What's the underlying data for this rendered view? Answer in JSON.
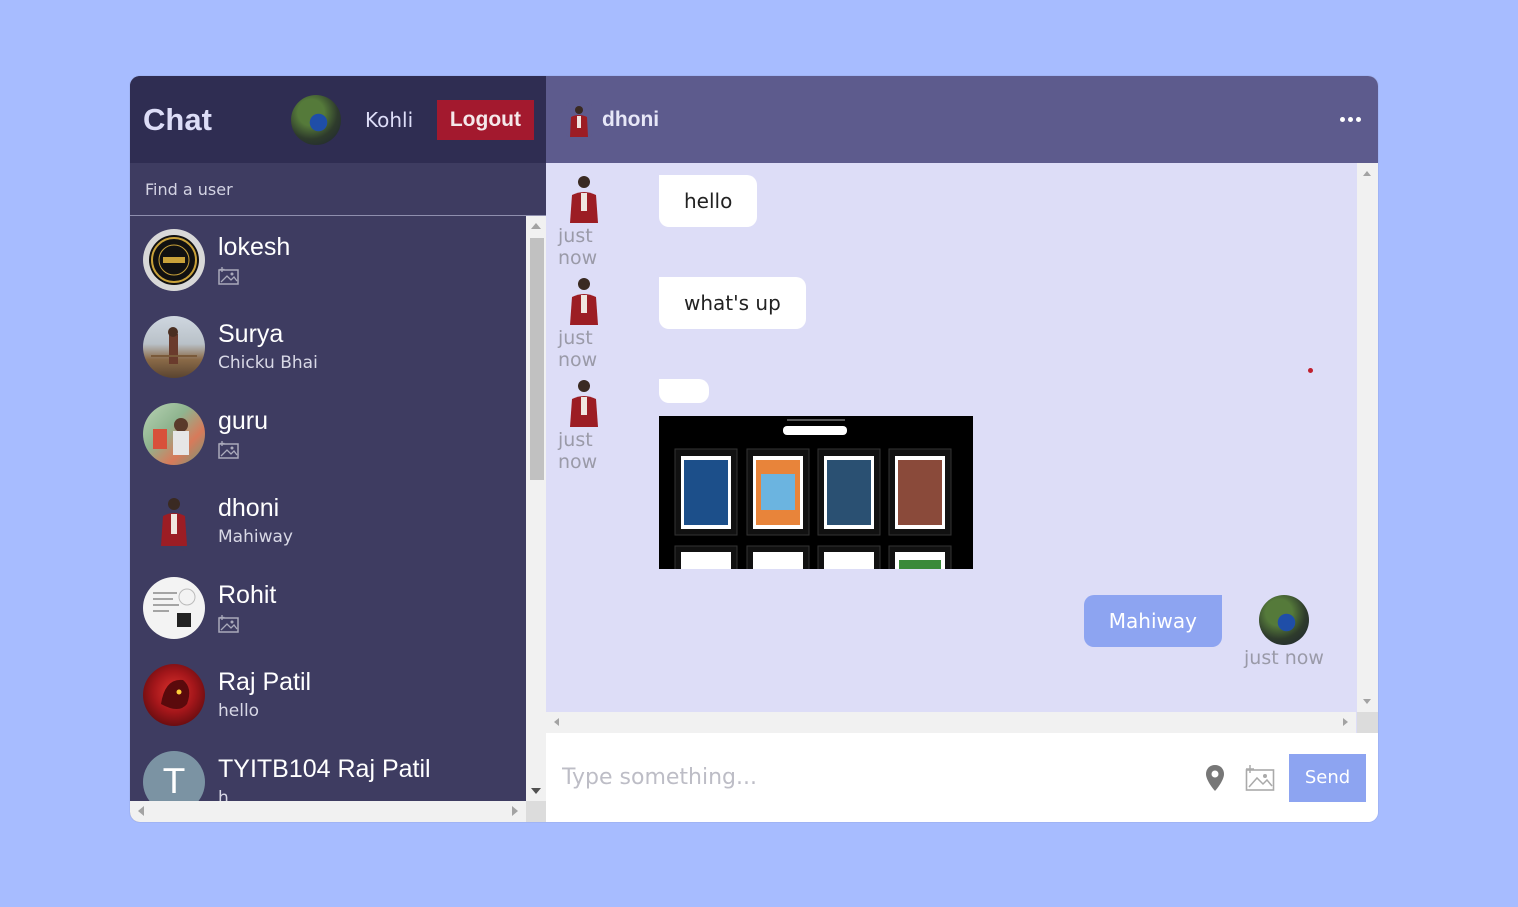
{
  "navbar": {
    "logo": "Chat",
    "current_user": "Kohli",
    "logout_label": "Logout"
  },
  "search": {
    "placeholder": "Find a user"
  },
  "chats": [
    {
      "name": "lokesh",
      "last_message": "",
      "last_is_image": true
    },
    {
      "name": "Surya",
      "last_message": "Chicku Bhai",
      "last_is_image": false
    },
    {
      "name": "guru",
      "last_message": "",
      "last_is_image": true
    },
    {
      "name": "dhoni",
      "last_message": "Mahiway",
      "last_is_image": false
    },
    {
      "name": "Rohit",
      "last_message": "",
      "last_is_image": true
    },
    {
      "name": "Raj Patil",
      "last_message": "hello",
      "last_is_image": false
    },
    {
      "name": "TYITB104 Raj Patil",
      "last_message": "h",
      "last_is_image": false,
      "avatar_letter": "T"
    }
  ],
  "chat_header": {
    "name": "dhoni"
  },
  "messages": [
    {
      "text": "hello",
      "time": "just now",
      "owner": false
    },
    {
      "text": "what's up",
      "time": "just now",
      "owner": false
    },
    {
      "text": "",
      "time": "just now",
      "owner": false,
      "has_image": true
    },
    {
      "text": "Mahiway",
      "time": "just now",
      "owner": true
    }
  ],
  "input": {
    "placeholder": "Type something...",
    "send_label": "Send"
  },
  "icons": {
    "location": "location-pin-icon",
    "attach_image": "image-icon",
    "more": "more-dots-icon"
  },
  "colors": {
    "background": "#a7bcff",
    "navbar": "#2f2d52",
    "sidebar": "#3e3c61",
    "chat_header": "#5d5b8d",
    "messages_bg": "#ddddf7",
    "owner_bubble": "#8da4f1",
    "logout": "#a3192e",
    "send": "#8da4f1"
  }
}
